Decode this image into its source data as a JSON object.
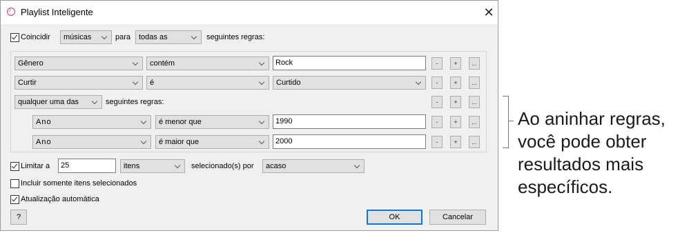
{
  "window": {
    "title": "Playlist Inteligente",
    "close_glyph": "✕"
  },
  "match": {
    "label": "Coincidir",
    "checked": true,
    "type_value": "músicas",
    "connector": "para",
    "scope_value": "todas as",
    "suffix": "seguintes regras:"
  },
  "rules": [
    {
      "field": "Gênero",
      "operator": "contém",
      "value": "Rock"
    },
    {
      "field": "Curtir",
      "operator": "é",
      "value": "Curtido"
    }
  ],
  "nested": {
    "scope_value": "qualquer uma das",
    "suffix": "seguintes regras:",
    "rules": [
      {
        "field": "Ano",
        "operator": "é menor que",
        "value": "1990"
      },
      {
        "field": "Ano",
        "operator": "é maior que",
        "value": "2000"
      }
    ]
  },
  "rule_buttons": {
    "remove": "-",
    "add": "+",
    "nest": "..."
  },
  "limit": {
    "label": "Limitar a",
    "checked": true,
    "value": "25",
    "unit": "itens",
    "selected_by_label": "selecionado(s) por",
    "selected_by_value": "acaso"
  },
  "only_checked": {
    "label": "Incluir somente itens selecionados",
    "checked": false
  },
  "live_update": {
    "label": "Atualização automática",
    "checked": true
  },
  "buttons": {
    "help": "?",
    "ok": "OK",
    "cancel": "Cancelar"
  },
  "callout_lines": [
    "Ao aninhar regras,",
    "você pode obter",
    "resultados mais",
    "específicos."
  ]
}
